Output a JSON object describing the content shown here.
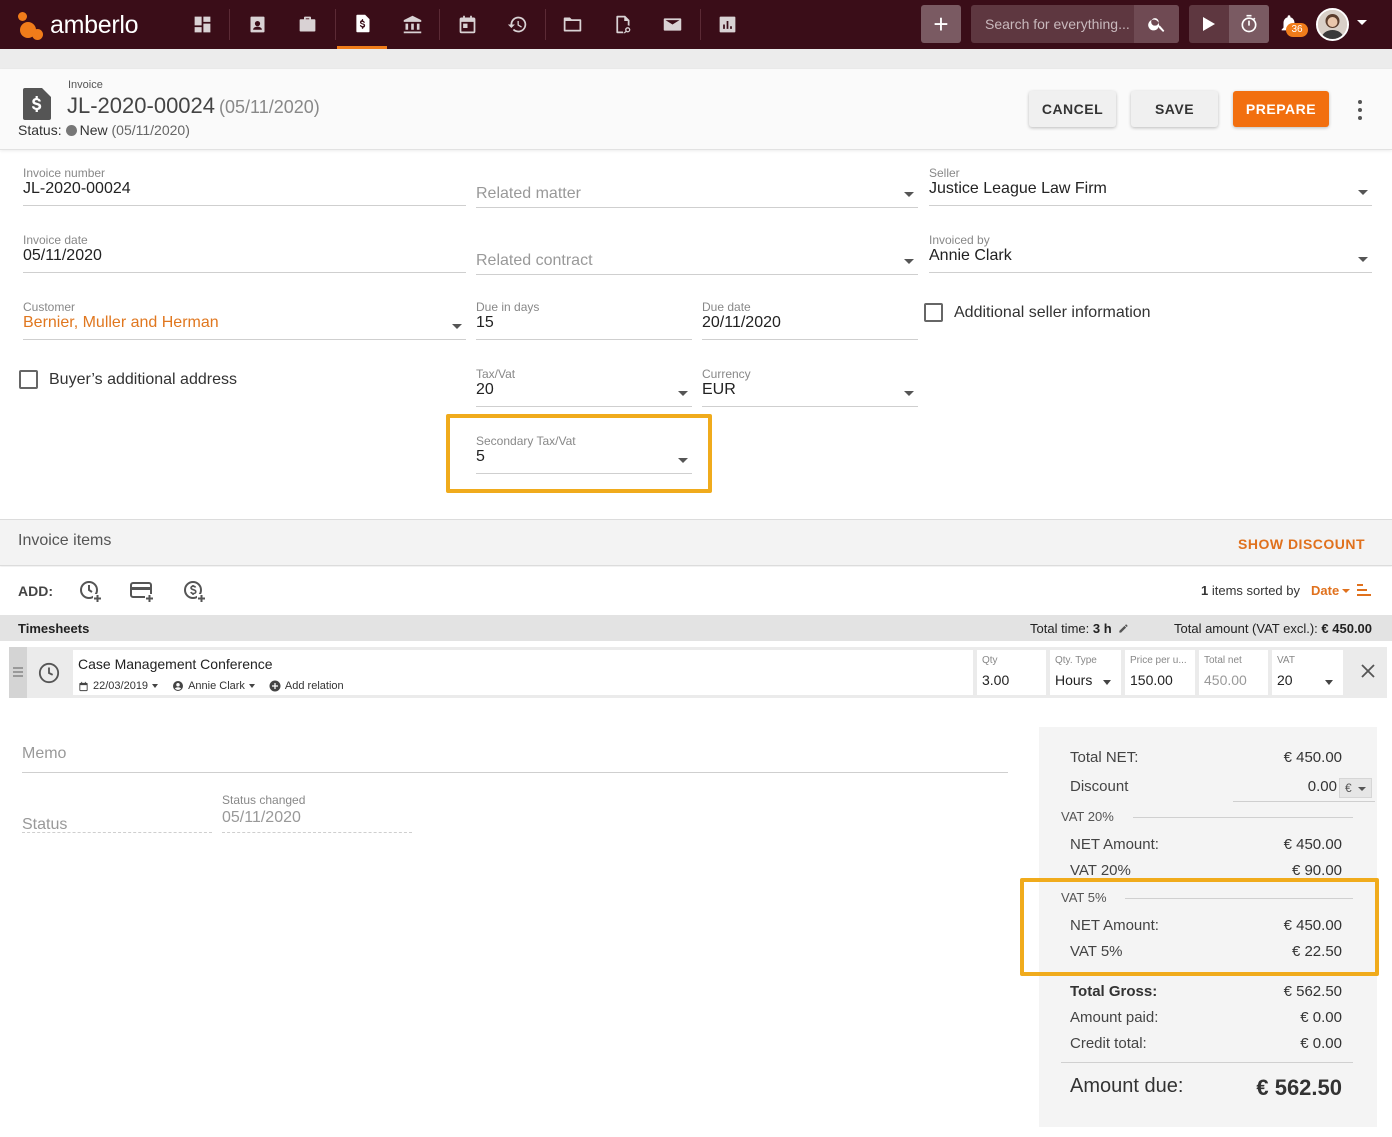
{
  "brand": {
    "name": "amberlo",
    "accent": "#f26f0f",
    "nav_bg": "#3a0d18",
    "highlight": "#f0ab1c"
  },
  "topnav": {
    "icons": [
      "dashboard-icon",
      "contacts-icon",
      "briefcase-icon",
      "invoice-icon",
      "bank-icon",
      "calendar-icon",
      "time-history-icon",
      "folder-icon",
      "document-search-icon",
      "mail-icon",
      "reports-icon"
    ],
    "search_placeholder": "Search for everything...",
    "notification_count": "36"
  },
  "header": {
    "small_label": "Invoice",
    "number": "JL-2020-00024",
    "date": "(05/11/2020)",
    "status_label": "Status:",
    "status_value": "New",
    "status_date": "(05/11/2020)",
    "buttons": {
      "cancel": "CANCEL",
      "save": "SAVE",
      "prepare": "PREPARE"
    }
  },
  "form": {
    "invoice_number": {
      "label": "Invoice number",
      "value": "JL-2020-00024"
    },
    "related_matter": {
      "placeholder": "Related matter"
    },
    "seller": {
      "label": "Seller",
      "value": "Justice League Law Firm"
    },
    "invoice_date": {
      "label": "Invoice date",
      "value": "05/11/2020"
    },
    "related_contract": {
      "placeholder": "Related contract"
    },
    "invoiced_by": {
      "label": "Invoiced by",
      "value": "Annie Clark"
    },
    "customer": {
      "label": "Customer",
      "value": "Bernier, Muller and Herman"
    },
    "due_in_days": {
      "label": "Due in days",
      "value": "15"
    },
    "due_date": {
      "label": "Due date",
      "value": "20/11/2020"
    },
    "additional_seller_info": "Additional seller information",
    "buyer_additional_address": "Buyer’s additional address",
    "tax_vat": {
      "label": "Tax/Vat",
      "value": "20"
    },
    "currency": {
      "label": "Currency",
      "value": "EUR"
    },
    "secondary_tax_vat": {
      "label": "Secondary Tax/Vat",
      "value": "5"
    }
  },
  "items": {
    "title": "Invoice items",
    "show_discount": "SHOW DISCOUNT",
    "add_label": "ADD:",
    "sort_count": "1",
    "sort_text": "items sorted by",
    "sort_field": "Date",
    "timesheets_title": "Timesheets",
    "total_time_label": "Total time:",
    "total_time_value": "3 h",
    "total_amount_label": "Total amount (VAT excl.):",
    "total_amount_value": "€ 450.00",
    "row": {
      "name": "Case Management Conference",
      "date": "22/03/2019",
      "user": "Annie Clark",
      "add_relation": "Add relation",
      "qty_label": "Qty",
      "qty": "3.00",
      "qty_type_label": "Qty. Type",
      "qty_type": "Hours",
      "price_label": "Price per u...",
      "price": "150.00",
      "total_net_label": "Total net",
      "total_net": "450.00",
      "vat_label": "VAT",
      "vat": "20"
    }
  },
  "memo": {
    "placeholder": "Memo"
  },
  "status_section": {
    "status_placeholder": "Status",
    "changed_label": "Status changed",
    "changed_value": "05/11/2020"
  },
  "totals": {
    "total_net_label": "Total NET:",
    "total_net": "€ 450.00",
    "discount_label": "Discount",
    "discount_value": "0.00",
    "discount_unit": "€",
    "vat20_section": "VAT 20%",
    "vat20_net_label": "NET Amount:",
    "vat20_net": "€ 450.00",
    "vat20_label": "VAT 20%",
    "vat20_value": "€ 90.00",
    "vat5_section": "VAT 5%",
    "vat5_net_label": "NET Amount:",
    "vat5_net": "€ 450.00",
    "vat5_label": "VAT 5%",
    "vat5_value": "€ 22.50",
    "gross_label": "Total Gross:",
    "gross": "€ 562.50",
    "paid_label": "Amount paid:",
    "paid": "€ 0.00",
    "credit_label": "Credit total:",
    "credit": "€ 0.00",
    "due_label": "Amount due:",
    "due": "€ 562.50"
  }
}
